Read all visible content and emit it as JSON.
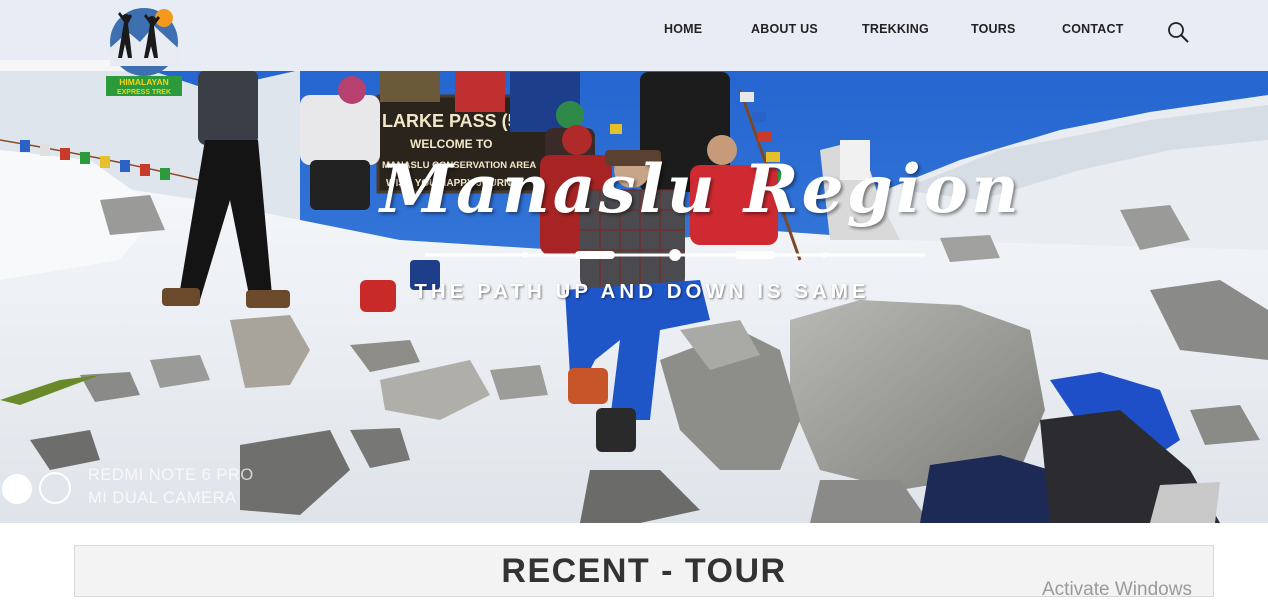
{
  "nav": {
    "home": "HOME",
    "about": "ABOUT US",
    "trekking": "TREKKING",
    "tours": "TOURS",
    "contact": "CONTACT"
  },
  "icons": {
    "search": "search-icon",
    "logo": "hiker-logo"
  },
  "logo": {
    "text_line1": "HIMALAYAN",
    "text_line2": "EXPRESS TREK"
  },
  "hero": {
    "title": "Manaslu Region",
    "subtitle": "THE PATH UP AND DOWN IS SAME",
    "sign_line1": "LARKE PASS (5106M)",
    "sign_line2": "WELCOME TO",
    "sign_line3": "MANASLU CONSERVATION AREA",
    "sign_line4": "WISH YOU HAPPY JOURNEY",
    "camera_line1": "REDMI NOTE 6 PRO",
    "camera_line2": "MI DUAL CAMERA"
  },
  "carousel": {
    "active_slide": 1,
    "total_slides": 2
  },
  "recent": {
    "title": "RECENT - TOUR"
  },
  "os_overlay": {
    "activate": "Activate Windows"
  },
  "colors": {
    "header_bg": "#f8f8f8",
    "sky": "#2e6fd6",
    "snow": "#eef1f5",
    "rock": "#9c9c9a",
    "nav_text": "#222222",
    "logo_green": "#2a9a3a",
    "logo_orange": "#f39a1e"
  }
}
